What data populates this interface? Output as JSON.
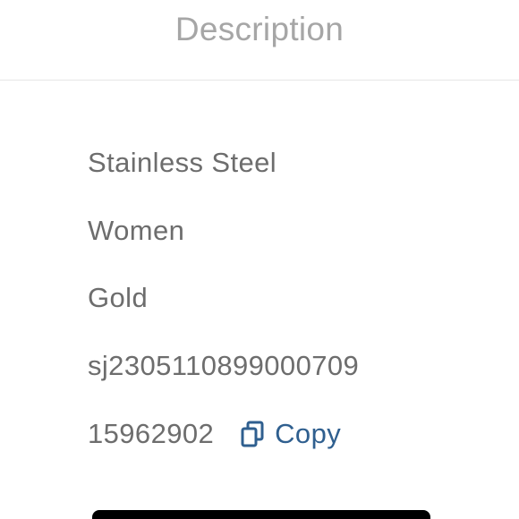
{
  "header": {
    "tab_title": "Description"
  },
  "details": {
    "material": "Stainless Steel",
    "gender": "Women",
    "color": "Gold",
    "sku": "sj2305110899000709",
    "item_id": "15962902",
    "copy_label": "Copy"
  },
  "colors": {
    "header_text": "#a6a6a6",
    "body_text": "#6d6d6d",
    "link": "#2f5f8f",
    "divider": "#e6e6e6"
  },
  "icons": {
    "copy": "copy-icon"
  }
}
